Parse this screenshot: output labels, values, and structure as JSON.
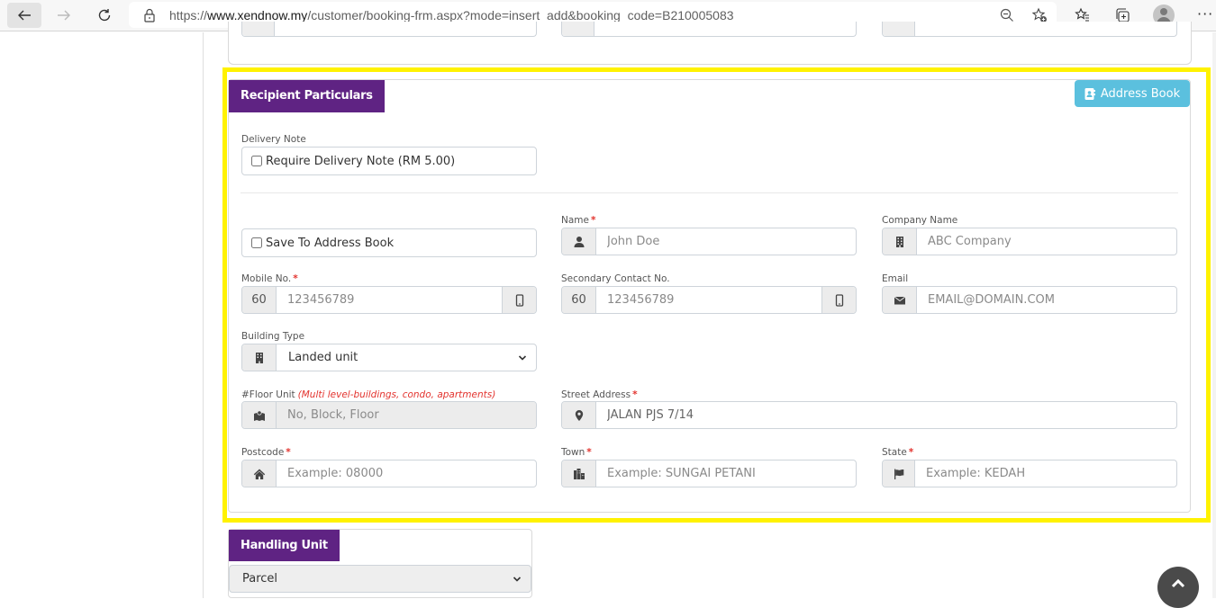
{
  "browser": {
    "url_prefix": "https://",
    "url_host": "www.xendnow.my",
    "url_path": "/customer/booking-frm.aspx?mode=insert_add&booking_code=B210005083",
    "icons": [
      "back-icon",
      "forward-icon",
      "refresh-icon",
      "lock-icon",
      "zoom-out-icon",
      "add-favorite-icon",
      "favorites-icon",
      "collections-icon",
      "profile-icon",
      "more-icon"
    ]
  },
  "recipient": {
    "title": "Recipient Particulars",
    "address_book_button": "Address Book",
    "delivery_note": {
      "label": "Delivery Note",
      "checkbox_label": "Require Delivery Note (RM 5.00)",
      "checked": false
    },
    "save_to_address_book": {
      "checkbox_label": "Save To Address Book",
      "checked": false
    },
    "name": {
      "label": "Name",
      "required": "*",
      "placeholder": "John Doe",
      "value": ""
    },
    "company_name": {
      "label": "Company Name",
      "placeholder": "ABC Company",
      "value": ""
    },
    "mobile_no": {
      "label": "Mobile No.",
      "required": "*",
      "prefix": "60",
      "placeholder": "123456789",
      "value": ""
    },
    "secondary_contact": {
      "label": "Secondary Contact No.",
      "prefix": "60",
      "placeholder": "123456789",
      "value": ""
    },
    "email": {
      "label": "Email",
      "placeholder": "EMAIL@DOMAIN.COM",
      "value": ""
    },
    "building_type": {
      "label": "Building Type",
      "selected": "Landed unit"
    },
    "floor_unit": {
      "label": "#Floor Unit",
      "hint": "(Multi level-buildings, condo, apartments)",
      "placeholder": "No, Block, Floor",
      "value": "",
      "disabled": true
    },
    "street_address": {
      "label": "Street Address",
      "required": "*",
      "placeholder": "",
      "value": "JALAN PJS 7/14"
    },
    "postcode": {
      "label": "Postcode",
      "required": "*",
      "placeholder": "Example: 08000",
      "value": ""
    },
    "town": {
      "label": "Town",
      "required": "*",
      "placeholder": "Example: SUNGAI PETANI",
      "value": ""
    },
    "state": {
      "label": "State",
      "required": "*",
      "placeholder": "Example: KEDAH",
      "value": ""
    }
  },
  "handling_unit": {
    "title": "Handling Unit",
    "selected": "Parcel"
  },
  "colors": {
    "brand_purple": "#5f2383",
    "info_button": "#5bc0de",
    "highlight": "#fff200",
    "required": "#e3342f"
  }
}
